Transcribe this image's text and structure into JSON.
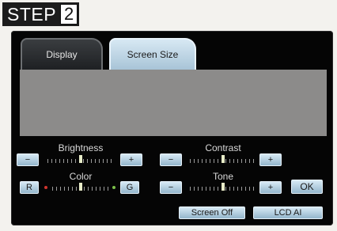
{
  "step": {
    "word": "STEP",
    "number": "2"
  },
  "tabs": {
    "display": "Display",
    "screen_size": "Screen Size"
  },
  "controls": {
    "brightness": {
      "label": "Brightness",
      "minus": "−",
      "plus": "+",
      "level": 0.5
    },
    "contrast": {
      "label": "Contrast",
      "minus": "−",
      "plus": "+",
      "level": 0.5
    },
    "color": {
      "label": "Color",
      "left": "R",
      "right": "G",
      "level": 0.5,
      "left_dot_color": "#d0352e",
      "right_dot_color": "#7cc04a"
    },
    "tone": {
      "label": "Tone",
      "minus": "−",
      "plus": "+",
      "level": 0.5
    }
  },
  "buttons": {
    "ok": "OK",
    "screen_off": "Screen Off",
    "lcd_ai": "LCD AI"
  },
  "colors": {
    "accent_button": "#a9c8dc",
    "panel_gray": "#8c8b8a",
    "screen_bg": "#050505"
  }
}
